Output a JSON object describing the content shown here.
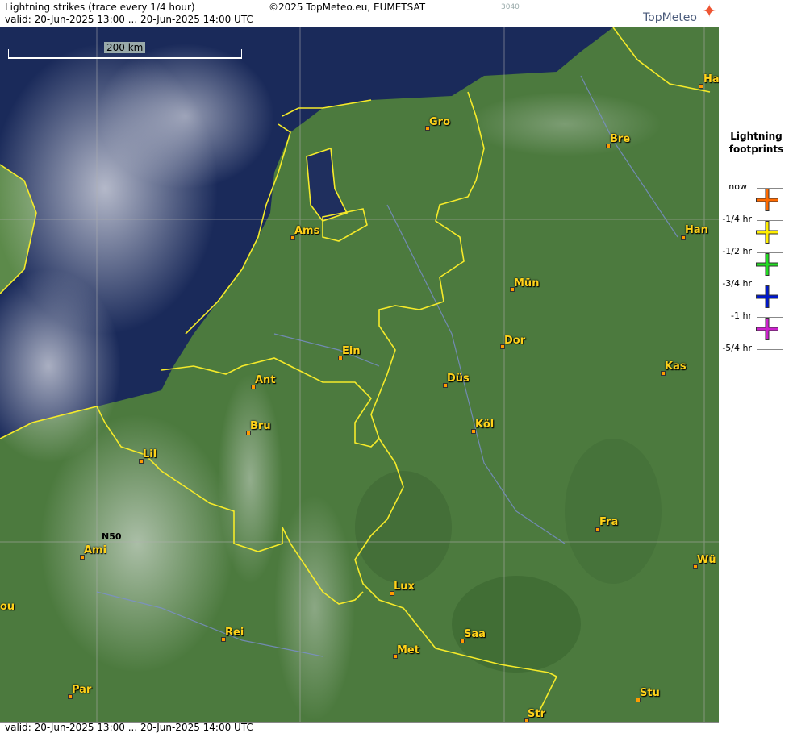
{
  "header": {
    "title": "Lightning strikes (trace every 1/4 hour)",
    "valid": "valid:  20-Jun-2025 13:00 ... 20-Jun-2025 14:00 UTC",
    "copyright": "©2025 TopMeteo.eu, EUMETSAT",
    "small_code": "3040",
    "logo_text": "TopMeteo"
  },
  "footer": {
    "valid": "valid:  20-Jun-2025 13:00 ... 20-Jun-2025 14:00 UTC"
  },
  "map": {
    "scale_label": "200 km",
    "lat_label": "N50",
    "cities": [
      "Gro",
      "Bre",
      "Ham",
      "Ams",
      "Han",
      "Mün",
      "Dor",
      "Ein",
      "Ant",
      "Düs",
      "Kas",
      "Bru",
      "Köl",
      "Lil",
      "Fra",
      "Ami",
      "Wü",
      "Lux",
      "Rei",
      "Saa",
      "Met",
      "Par",
      "Stu",
      "Str",
      "ou"
    ]
  },
  "legend": {
    "title_line1": "Lightning",
    "title_line2": "footprints",
    "entries": [
      {
        "label": "now",
        "color": "#ff6a00"
      },
      {
        "label": "-1/4 hr",
        "color": "#ffee00"
      },
      {
        "label": "-1/2 hr",
        "color": "#22dd22"
      },
      {
        "label": "-3/4 hr",
        "color": "#0018cc"
      },
      {
        "label": "-1 hr",
        "color": "#cc22cc"
      },
      {
        "label": "-5/4 hr",
        "color": ""
      }
    ]
  }
}
